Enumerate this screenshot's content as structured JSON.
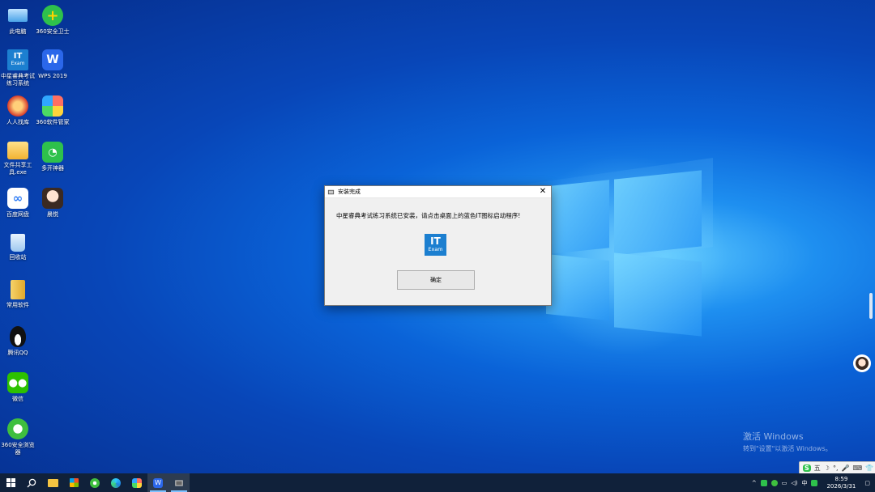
{
  "desktop": {
    "icons": [
      {
        "label": "此电脑",
        "icon": "computer-icon"
      },
      {
        "label": "360安全卫士",
        "icon": "360-safeguard-icon"
      },
      {
        "label": "中星睿典考试练习系统",
        "icon": "it-exam-icon",
        "badge": "IT",
        "sub": "Exam"
      },
      {
        "label": "WPS 2019",
        "icon": "wps-icon"
      },
      {
        "label": "人人找库",
        "icon": "game-character-icon"
      },
      {
        "label": "360软件管家",
        "icon": "360-software-manager-icon"
      },
      {
        "label": "文件共享工具.exe",
        "icon": "folder-icon"
      },
      {
        "label": "多开神器",
        "icon": "multi-open-icon"
      },
      {
        "label": "百度网盘",
        "icon": "baidu-netdisk-icon"
      },
      {
        "label": "晨悦",
        "icon": "avatar-icon"
      },
      {
        "label": "回收站",
        "icon": "recycle-bin-icon"
      },
      {
        "label": "常用软件",
        "icon": "folder-archive-icon"
      },
      {
        "label": "腾讯QQ",
        "icon": "qq-penguin-icon"
      },
      {
        "label": "微信",
        "icon": "wechat-icon"
      },
      {
        "label": "360安全浏览器",
        "icon": "360-browser-icon"
      }
    ]
  },
  "dialog": {
    "title": "安装完成",
    "message": "中星睿典考试练习系统已安装，请点击桌面上的蓝色IT图标启动程序!",
    "logo_text": "IT",
    "logo_sub": "Exam",
    "ok_label": "确定",
    "close_glyph": "✕"
  },
  "activation": {
    "title": "激活 Windows",
    "subtitle": "转到\"设置\"以激活 Windows。"
  },
  "ime": {
    "mode": "五"
  },
  "tray": {
    "lang": "中",
    "time": "8:59",
    "date": "2026/3/31"
  },
  "colors": {
    "taskbar": "#10213a",
    "accent": "#0a63d8",
    "it_blue": "#1c7fd0"
  }
}
